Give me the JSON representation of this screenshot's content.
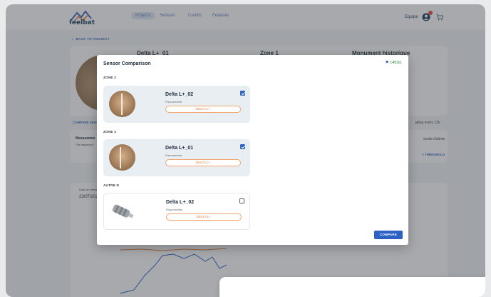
{
  "brand": {
    "name": "feelbat"
  },
  "nav": [
    {
      "label": "Projects",
      "active": true
    },
    {
      "label": "Sensors",
      "active": false
    },
    {
      "label": "Credits",
      "active": false
    },
    {
      "label": "Features",
      "active": false
    }
  ],
  "header": {
    "team_label": "Equipe",
    "notification_count": "1"
  },
  "back_link": "BACK TO PROJECT",
  "background": {
    "sensor_title": "Delta L+_01",
    "zone_title": "Zone 1",
    "monument_title": "Monument historique",
    "compare_link": "COMPARE SENS",
    "measurement_label": "Measureme",
    "measurement_sub": "The displaced",
    "date_label": "Date de relevé",
    "date_value": "23/07/2025",
    "alert_label": "seuils d'alerte",
    "threshold_link": "T THRESHOLD",
    "reading_label": "ading every 12h"
  },
  "modal": {
    "title": "Sensor Comparison",
    "count": "1453d.",
    "compare_label": "COMPARE",
    "groups": [
      {
        "zone": "ZONE 2",
        "sensor": {
          "name": "Delta L+_02",
          "type": "Fissuremètre",
          "badge": "DELTA L+",
          "checked": true,
          "thumb": "crack"
        }
      },
      {
        "zone": "ZONE 3",
        "sensor": {
          "name": "Delta L+_01",
          "type": "Fissuremètre",
          "badge": "DELTA L+",
          "checked": true,
          "thumb": "crack"
        }
      },
      {
        "zone": "AUTRE N",
        "sensor": {
          "name": "Delta L+_02",
          "type": "Fissuremètre",
          "badge": "DELTA L+",
          "checked": false,
          "thumb": "metal"
        }
      }
    ]
  },
  "colors": {
    "accent": "#2b62c4",
    "badge": "#e07b39",
    "brand_dark": "#1b3a5c"
  }
}
